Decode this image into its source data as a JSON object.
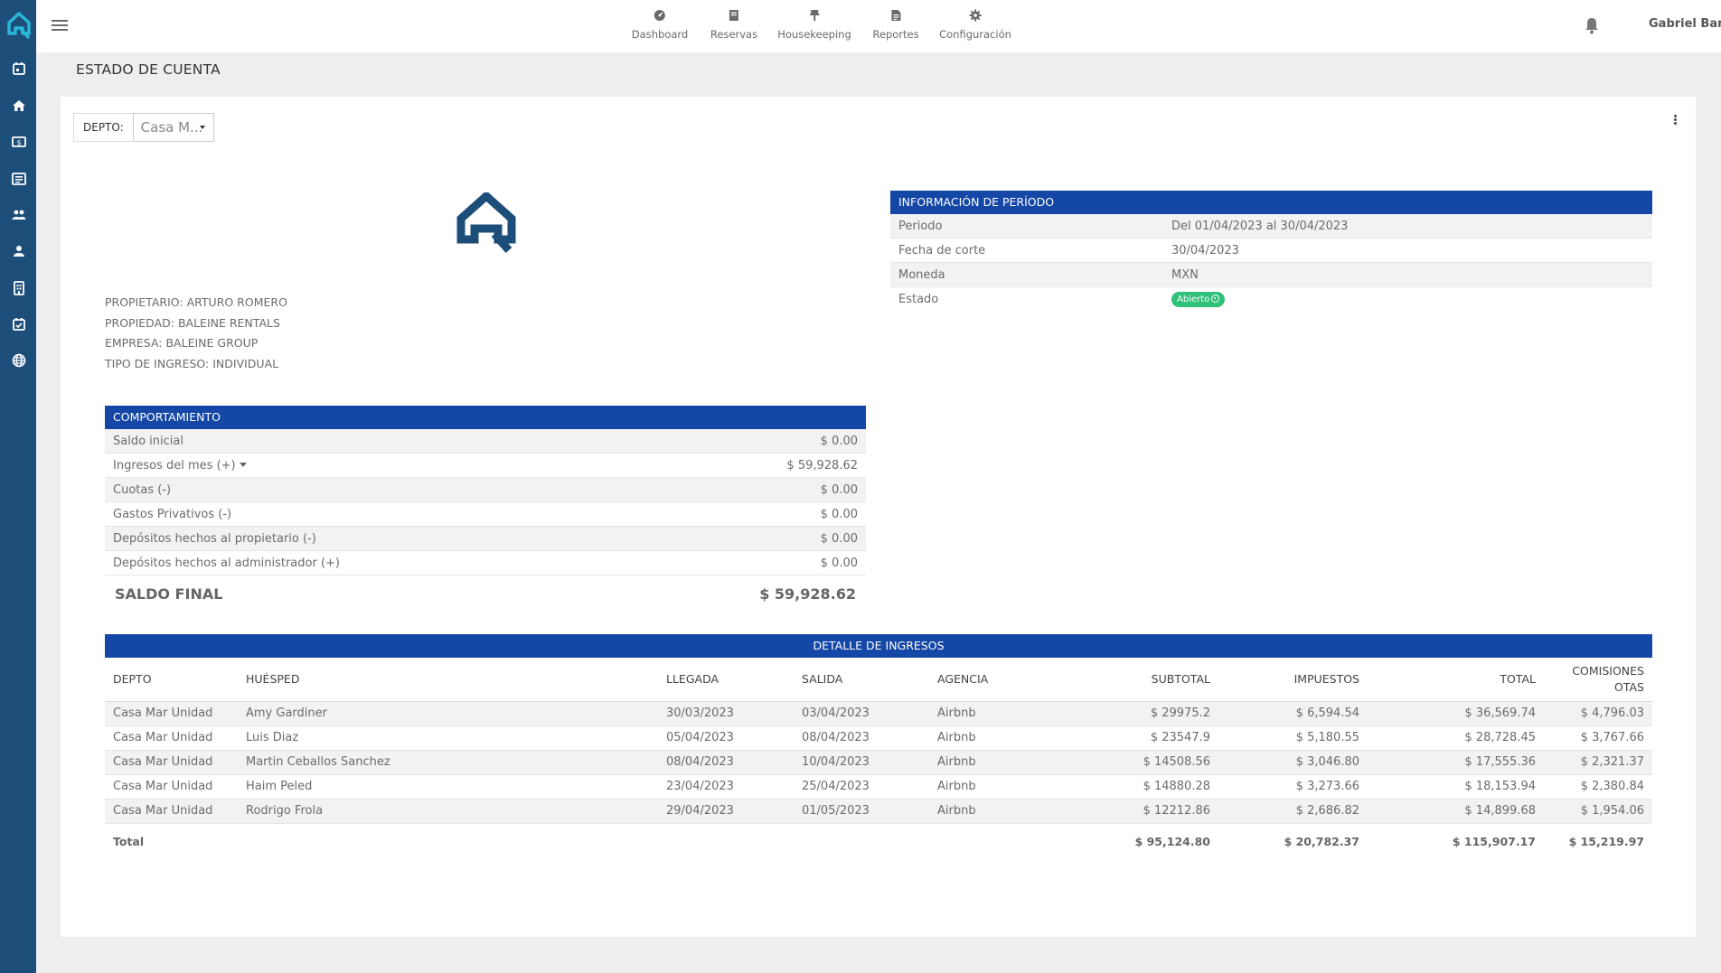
{
  "nav": {
    "items": [
      {
        "label": "Dashboard",
        "icon": "dashboard-icon"
      },
      {
        "label": "Reservas",
        "icon": "book-icon"
      },
      {
        "label": "Housekeeping",
        "icon": "housekeeping-icon"
      },
      {
        "label": "Reportes",
        "icon": "report-icon"
      },
      {
        "label": "Configuración",
        "icon": "gear-icon"
      }
    ]
  },
  "user": {
    "name": "Gabriel Banda"
  },
  "page": {
    "title": "ESTADO DE CUENTA"
  },
  "filter": {
    "label": "DEPTO:",
    "value": "Casa M..."
  },
  "owner": {
    "propietario": "PROPIETARIO: ARTURO ROMERO",
    "propiedad": "PROPIEDAD: BALEINE RENTALS",
    "empresa": "EMPRESA: BALEINE GROUP",
    "tipo": "TIPO DE INGRESO: INDIVIDUAL"
  },
  "periodo": {
    "title": "INFORMACIÓN DE PERÍODO",
    "rows": [
      {
        "label": "Periodo",
        "value": "Del 01/04/2023 al 30/04/2023"
      },
      {
        "label": "Fecha de corte",
        "value": "30/04/2023"
      },
      {
        "label": "Moneda",
        "value": "MXN"
      },
      {
        "label": "Estado",
        "value": "Abierto"
      }
    ]
  },
  "comportamiento": {
    "title": "COMPORTAMIENTO",
    "rows": [
      {
        "label": "Saldo inicial",
        "value": "$ 0.00"
      },
      {
        "label": "Ingresos del mes (+)",
        "value": "$ 59,928.62"
      },
      {
        "label": "Cuotas (-)",
        "value": "$ 0.00"
      },
      {
        "label": "Gastos Privativos (-)",
        "value": "$ 0.00"
      },
      {
        "label": "Depósitos hechos al propietario (-)",
        "value": "$ 0.00"
      },
      {
        "label": "Depósitos hechos al administrador (+)",
        "value": "$ 0.00"
      }
    ],
    "final_label": "SALDO FINAL",
    "final_value": "$ 59,928.62"
  },
  "detalle": {
    "title": "DETALLE DE INGRESOS",
    "columns": [
      "DEPTO",
      "HUÉSPED",
      "LLEGADA",
      "SALIDA",
      "AGENCIA",
      "SUBTOTAL",
      "IMPUESTOS",
      "TOTAL",
      "COMISIONES OTAS"
    ],
    "rows": [
      [
        "Casa Mar Unidad",
        "Amy Gardiner",
        "30/03/2023",
        "03/04/2023",
        "Airbnb",
        "$ 29975.2",
        "$ 6,594.54",
        "$ 36,569.74",
        "$ 4,796.03"
      ],
      [
        "Casa Mar Unidad",
        "Luis Diaz",
        "05/04/2023",
        "08/04/2023",
        "Airbnb",
        "$ 23547.9",
        "$ 5,180.55",
        "$ 28,728.45",
        "$ 3,767.66"
      ],
      [
        "Casa Mar Unidad",
        "Martin Ceballos Sanchez",
        "08/04/2023",
        "10/04/2023",
        "Airbnb",
        "$ 14508.56",
        "$ 3,046.80",
        "$ 17,555.36",
        "$ 2,321.37"
      ],
      [
        "Casa Mar Unidad",
        "Haim Peled",
        "23/04/2023",
        "25/04/2023",
        "Airbnb",
        "$ 14880.28",
        "$ 3,273.66",
        "$ 18,153.94",
        "$ 2,380.84"
      ],
      [
        "Casa Mar Unidad",
        "Rodrigo Frola",
        "29/04/2023",
        "01/05/2023",
        "Airbnb",
        "$ 12212.86",
        "$ 2,686.82",
        "$ 14,899.68",
        "$ 1,954.06"
      ]
    ],
    "total_label": "Total",
    "totals": [
      "$ 95,124.80",
      "$ 20,782.37",
      "$ 115,907.17",
      "$ 15,219.97"
    ]
  },
  "colors": {
    "sidebar": "#1d4e7a",
    "header": "#1447a6",
    "badge": "#2fc07a"
  }
}
